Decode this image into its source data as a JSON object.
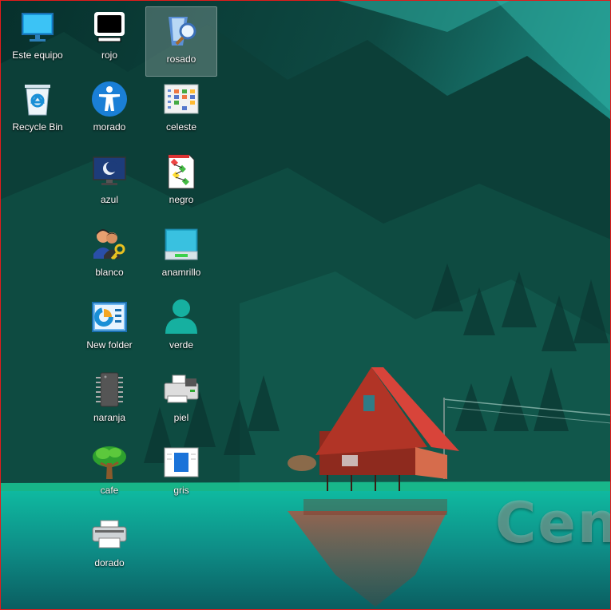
{
  "desktop": {
    "icons": [
      {
        "label": "Este equipo",
        "icon": "monitor-icon"
      },
      {
        "label": "rojo",
        "icon": "black-monitor-icon"
      },
      {
        "label": "rosado",
        "icon": "magnifier-mirror-icon",
        "selected": true
      },
      {
        "label": "Recycle Bin",
        "icon": "recycle-bin-icon"
      },
      {
        "label": "morado",
        "icon": "accessibility-icon"
      },
      {
        "label": "celeste",
        "icon": "control-panel-grid-icon"
      },
      {
        "label": "azul",
        "icon": "sleep-monitor-icon"
      },
      {
        "label": "negro",
        "icon": "flowchart-document-icon"
      },
      {
        "label": "blanco",
        "icon": "users-key-icon"
      },
      {
        "label": "anamrillo",
        "icon": "drive-monitor-icon"
      },
      {
        "label": "New folder",
        "icon": "presentation-chart-icon"
      },
      {
        "label": "verde",
        "icon": "user-avatar-icon"
      },
      {
        "label": "naranja",
        "icon": "memory-chip-icon"
      },
      {
        "label": "piel",
        "icon": "fax-printer-icon"
      },
      {
        "label": "cafe",
        "icon": "tree-icon"
      },
      {
        "label": "gris",
        "icon": "document-window-icon"
      },
      {
        "label": "dorado",
        "icon": "printer-icon"
      }
    ]
  },
  "wallpaper": {
    "watermark_text": "Cen",
    "colors": {
      "sky": "#1b8c86",
      "forest": "#0f4a40",
      "water": "#16c2a6",
      "cabin": "#c0392b"
    }
  }
}
